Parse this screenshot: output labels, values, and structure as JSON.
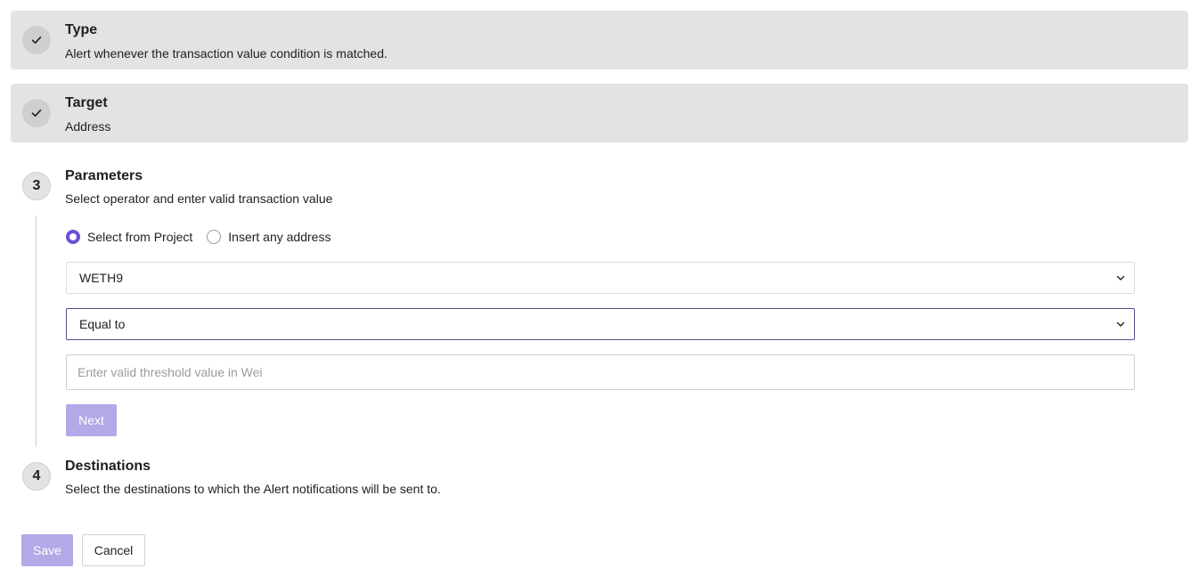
{
  "steps": {
    "type": {
      "title": "Type",
      "description": "Alert whenever the transaction value condition is matched."
    },
    "target": {
      "title": "Target",
      "description": "Address"
    },
    "parameters": {
      "number": "3",
      "title": "Parameters",
      "description": "Select operator and enter valid transaction value"
    },
    "destinations": {
      "number": "4",
      "title": "Destinations",
      "description": "Select the destinations to which the Alert notifications will be sent to."
    }
  },
  "parameters_form": {
    "radio_options": [
      {
        "label": "Select from Project",
        "checked": true
      },
      {
        "label": "Insert any address",
        "checked": false
      }
    ],
    "asset_select_value": "WETH9",
    "operator_select_value": "Equal to",
    "threshold_placeholder": "Enter valid threshold value in Wei",
    "threshold_value": "",
    "next_label": "Next"
  },
  "footer": {
    "save_label": "Save",
    "cancel_label": "Cancel"
  },
  "colors": {
    "accent": "#6b4fd6",
    "accent_disabled": "#b5a8e6",
    "completed_card_bg": "#e3e3e3"
  },
  "icons": {
    "completed_step": "check-icon",
    "select_arrow": "chevron-down-icon"
  }
}
